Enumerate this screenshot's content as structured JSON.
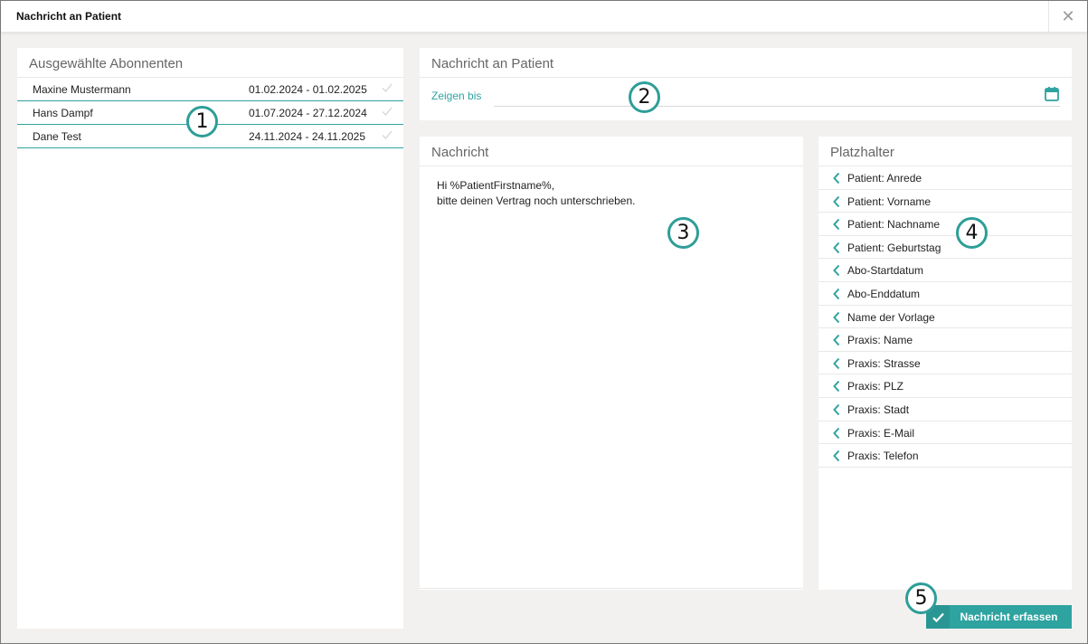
{
  "window": {
    "title": "Nachricht an Patient",
    "close_icon": "close-icon"
  },
  "subscribers": {
    "header": "Ausgewählte Abonnenten",
    "rows": [
      {
        "name": "Maxine Mustermann",
        "dates": "01.02.2024 - 01.02.2025"
      },
      {
        "name": "Hans Dampf",
        "dates": "01.07.2024 - 27.12.2024"
      },
      {
        "name": "Dane Test",
        "dates": "24.11.2024 - 24.11.2025"
      }
    ]
  },
  "message_header": {
    "title": "Nachricht an Patient",
    "show_until_label": "Zeigen bis",
    "show_until_value": ""
  },
  "message": {
    "header": "Nachricht",
    "text": "Hi %PatientFirstname%,\nbitte deinen Vertrag noch unterschrieben."
  },
  "placeholders": {
    "header": "Platzhalter",
    "items": [
      "Patient: Anrede",
      "Patient: Vorname",
      "Patient: Nachname",
      "Patient: Geburtstag",
      "Abo-Startdatum",
      "Abo-Enddatum",
      "Name der Vorlage",
      "Praxis: Name",
      "Praxis: Strasse",
      "Praxis: PLZ",
      "Praxis: Stadt",
      "Praxis: E-Mail",
      "Praxis: Telefon"
    ]
  },
  "submit": {
    "label": "Nachricht erfassen"
  },
  "badges": [
    "1",
    "2",
    "3",
    "4",
    "5"
  ],
  "colors": {
    "accent": "#2ea3a0",
    "badge_border": "#2e9e98",
    "background": "#f3f1ef"
  }
}
